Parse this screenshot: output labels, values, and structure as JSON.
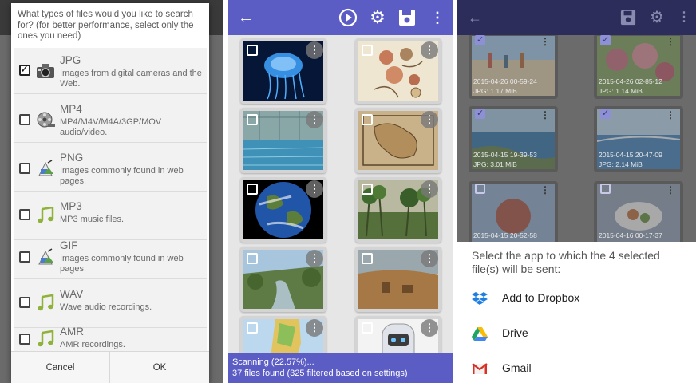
{
  "file_type_dialog": {
    "prompt": "What types of files would you like to search for? (for better performance, select only the ones you need)",
    "items": [
      {
        "name": "JPG",
        "description": "Images from digital cameras and the Web.",
        "checked": true,
        "icon": "camera-icon"
      },
      {
        "name": "MP4",
        "description": "MP4/M4V/M4A/3GP/MOV audio/video.",
        "checked": false,
        "icon": "film-reel-icon"
      },
      {
        "name": "PNG",
        "description": "Images commonly found in web pages.",
        "checked": false,
        "icon": "image-file-icon"
      },
      {
        "name": "MP3",
        "description": "MP3 music files.",
        "checked": false,
        "icon": "music-note-icon"
      },
      {
        "name": "GIF",
        "description": "Images commonly found in web pages.",
        "checked": false,
        "icon": "image-file-icon"
      },
      {
        "name": "WAV",
        "description": "Wave audio recordings.",
        "checked": false,
        "icon": "music-note-icon"
      },
      {
        "name": "AMR",
        "description": "AMR recordings.",
        "checked": false,
        "icon": "music-note-icon"
      }
    ],
    "cancel_label": "Cancel",
    "ok_label": "OK"
  },
  "scan_screen": {
    "toolbar": {
      "back": "←",
      "play": "▶",
      "settings": "⚙",
      "save": "💾",
      "more": "⋮"
    },
    "menu_glyph": "⋮",
    "thumbnails": [
      {
        "subject": "jellyfish",
        "color": "#0a2a66"
      },
      {
        "subject": "botanical-illustration",
        "color": "#efe6d2"
      },
      {
        "subject": "indoor-pool",
        "color": "#5b8fa8"
      },
      {
        "subject": "antique-map",
        "color": "#b89a6a"
      },
      {
        "subject": "earth-globe",
        "color": "#1b3d7a"
      },
      {
        "subject": "jungle-painting",
        "color": "#4d6b3a"
      },
      {
        "subject": "river-valley",
        "color": "#5e7a45"
      },
      {
        "subject": "desert-ruins",
        "color": "#a57846"
      },
      {
        "subject": "lebanon-map",
        "color": "#d9c27a"
      },
      {
        "subject": "robot",
        "color": "#e0e3ea"
      }
    ],
    "status_line1": "Scanning (22.57%)...",
    "status_line2": "37 files found (325 filtered based on settings)",
    "progress_percent": 22.57
  },
  "share_screen": {
    "toolbar": {
      "back": "←",
      "save": "💾",
      "settings": "⚙",
      "more": "⋮"
    },
    "menu_glyph": "⋮",
    "thumbnails": [
      {
        "date": "2015-04-26 00-59-24",
        "size": "JPG: 1.17 MiB",
        "checked": true,
        "color": "#9ec4e6"
      },
      {
        "date": "2015-04-26 02-85-12",
        "size": "JPG: 1.14 MiB",
        "checked": true,
        "color": "#7d9b5a"
      },
      {
        "date": "2015-04-15 19-39-53",
        "size": "JPG: 3.01 MiB",
        "checked": true,
        "color": "#4f88b8"
      },
      {
        "date": "2015-04-15 20-47-09",
        "size": "JPG: 2.14 MiB",
        "checked": true,
        "color": "#6e9ac4"
      },
      {
        "date": "2015-04-15 20-52-58",
        "size": "",
        "checked": false,
        "color": "#a34f3e"
      },
      {
        "date": "2015-04-16 00-17-37",
        "size": "",
        "checked": false,
        "color": "#8a9bb0"
      }
    ],
    "sheet_title": "Select the app to which the 4 selected file(s) will be sent:",
    "apps": [
      {
        "label": "Add to Dropbox",
        "icon": "dropbox-icon",
        "color": "#1f7fe0"
      },
      {
        "label": "Drive",
        "icon": "google-drive-icon",
        "color": "#1fa463"
      },
      {
        "label": "Gmail",
        "icon": "gmail-icon",
        "color": "#d93025"
      }
    ]
  }
}
